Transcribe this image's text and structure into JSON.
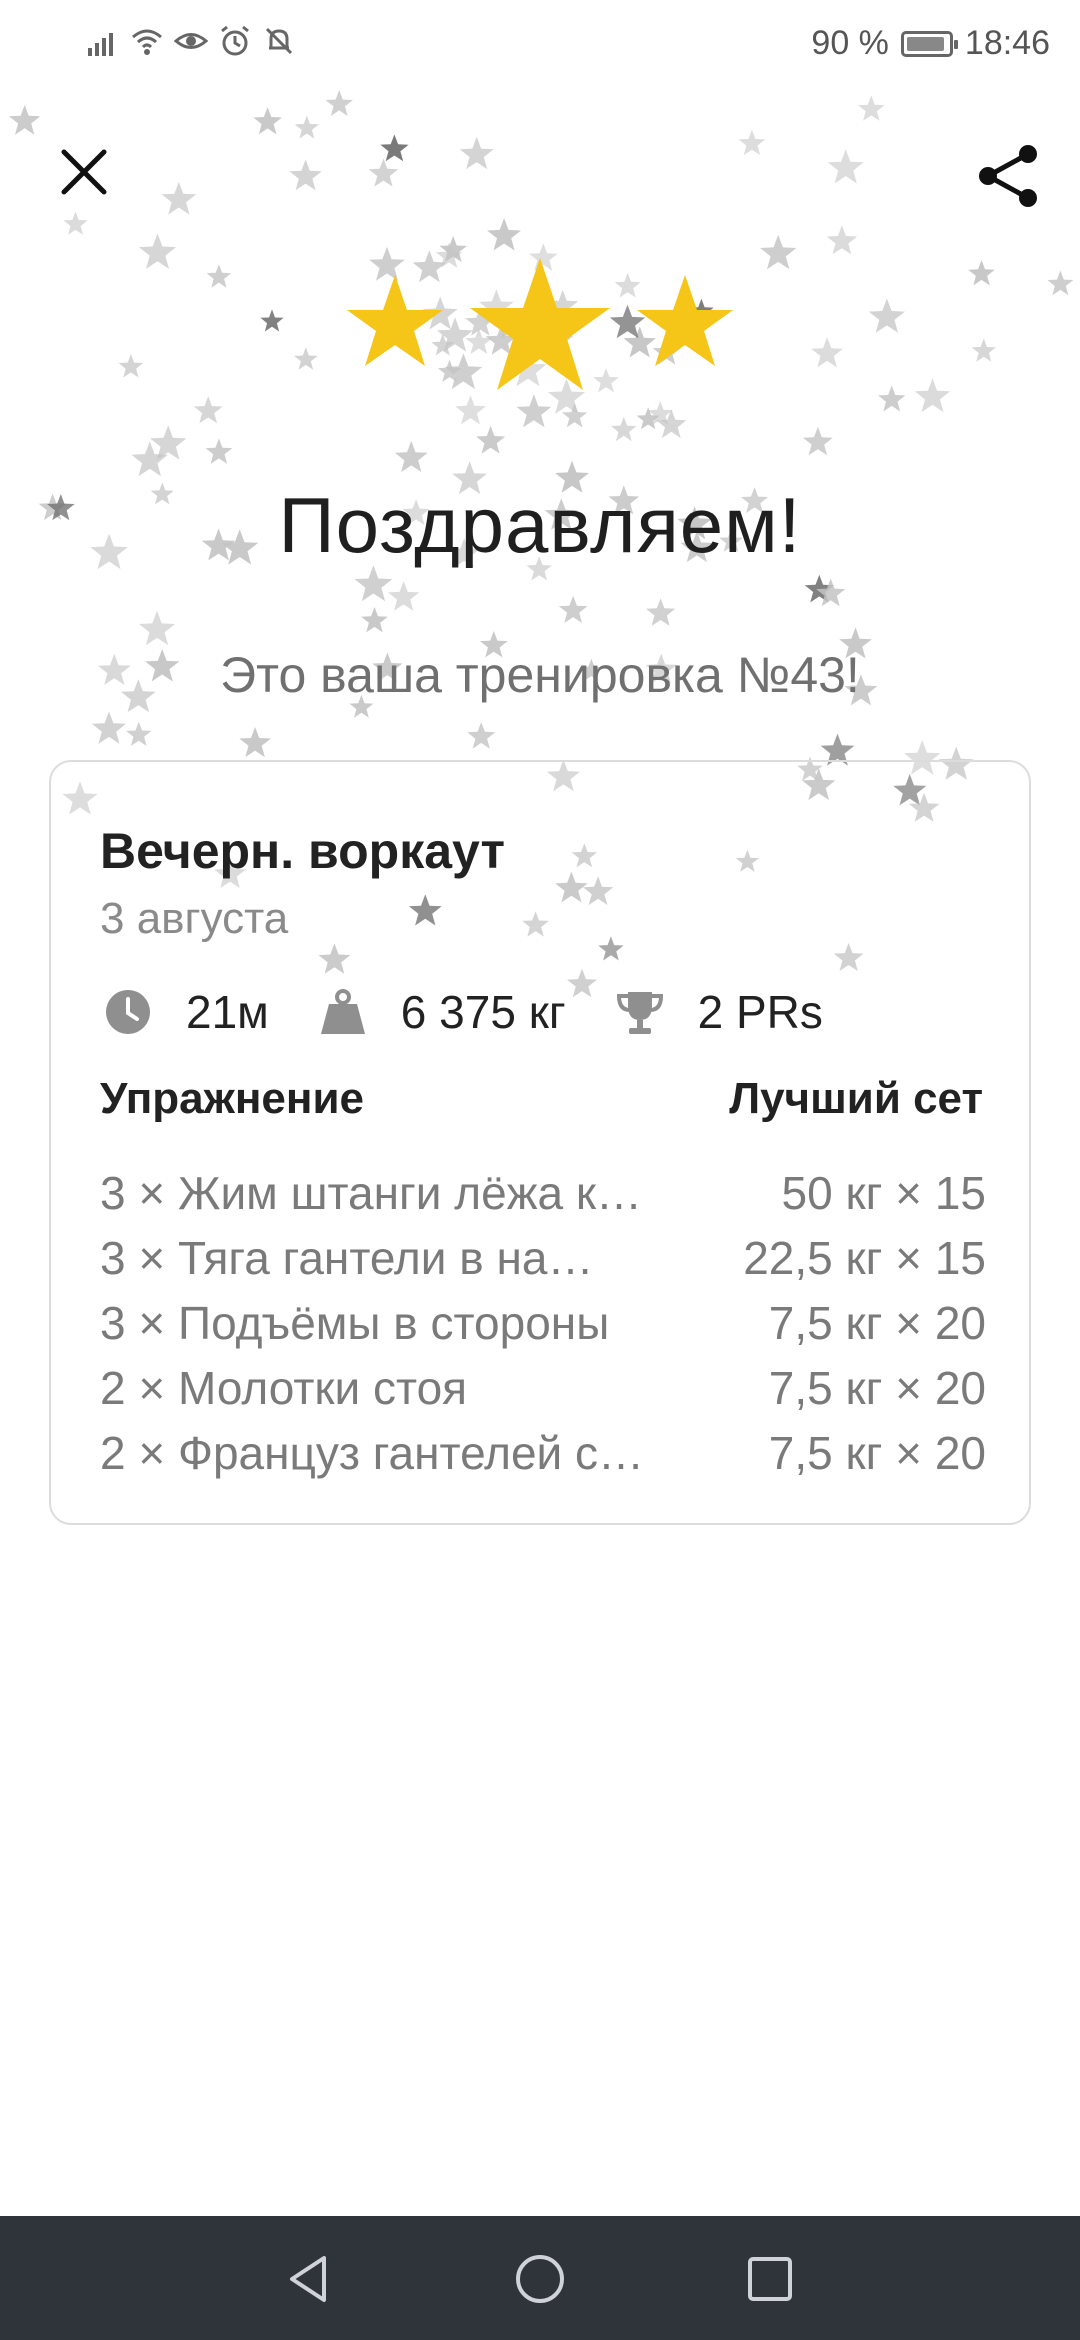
{
  "status_bar": {
    "battery_percent": "90 %",
    "time": "18:46",
    "battery_level": 0.9,
    "icons": [
      "signal-icon",
      "wifi-icon",
      "eye-icon",
      "alarm-icon",
      "bell-off-icon",
      "battery-icon"
    ]
  },
  "header": {
    "close_icon": "close-icon",
    "share_icon": "share-icon"
  },
  "rating": {
    "stars": 3,
    "star_color": "#F5C518"
  },
  "headline": "Поздравляем!",
  "subhead": "Это ваша тренировка №43!",
  "card": {
    "title": "Вечерн. воркаут",
    "date": "3 августа",
    "stats": {
      "duration": "21м",
      "volume": "6 375 кг",
      "prs": "2 PRs"
    },
    "columns": {
      "exercise": "Упражнение",
      "best_set": "Лучший сет"
    },
    "rows": [
      {
        "name": "3 × Жим штанги лёжа к…",
        "best": "50 кг × 15"
      },
      {
        "name": "3 × Тяга гантели в на…",
        "best": "22,5 кг × 15"
      },
      {
        "name": "3 × Подъёмы в стороны",
        "best": "7,5 кг × 20"
      },
      {
        "name": "2 × Молотки стоя",
        "best": "7,5 кг × 20"
      },
      {
        "name": "2 × Француз гантелей с…",
        "best": "7,5 кг × 20"
      }
    ]
  },
  "colors": {
    "accent_star": "#F5C518",
    "confetti": "#bdbdbd",
    "navbar": "#2f333a"
  },
  "navbar": {
    "icons": [
      "back-triangle-icon",
      "home-circle-icon",
      "recents-square-icon"
    ]
  }
}
